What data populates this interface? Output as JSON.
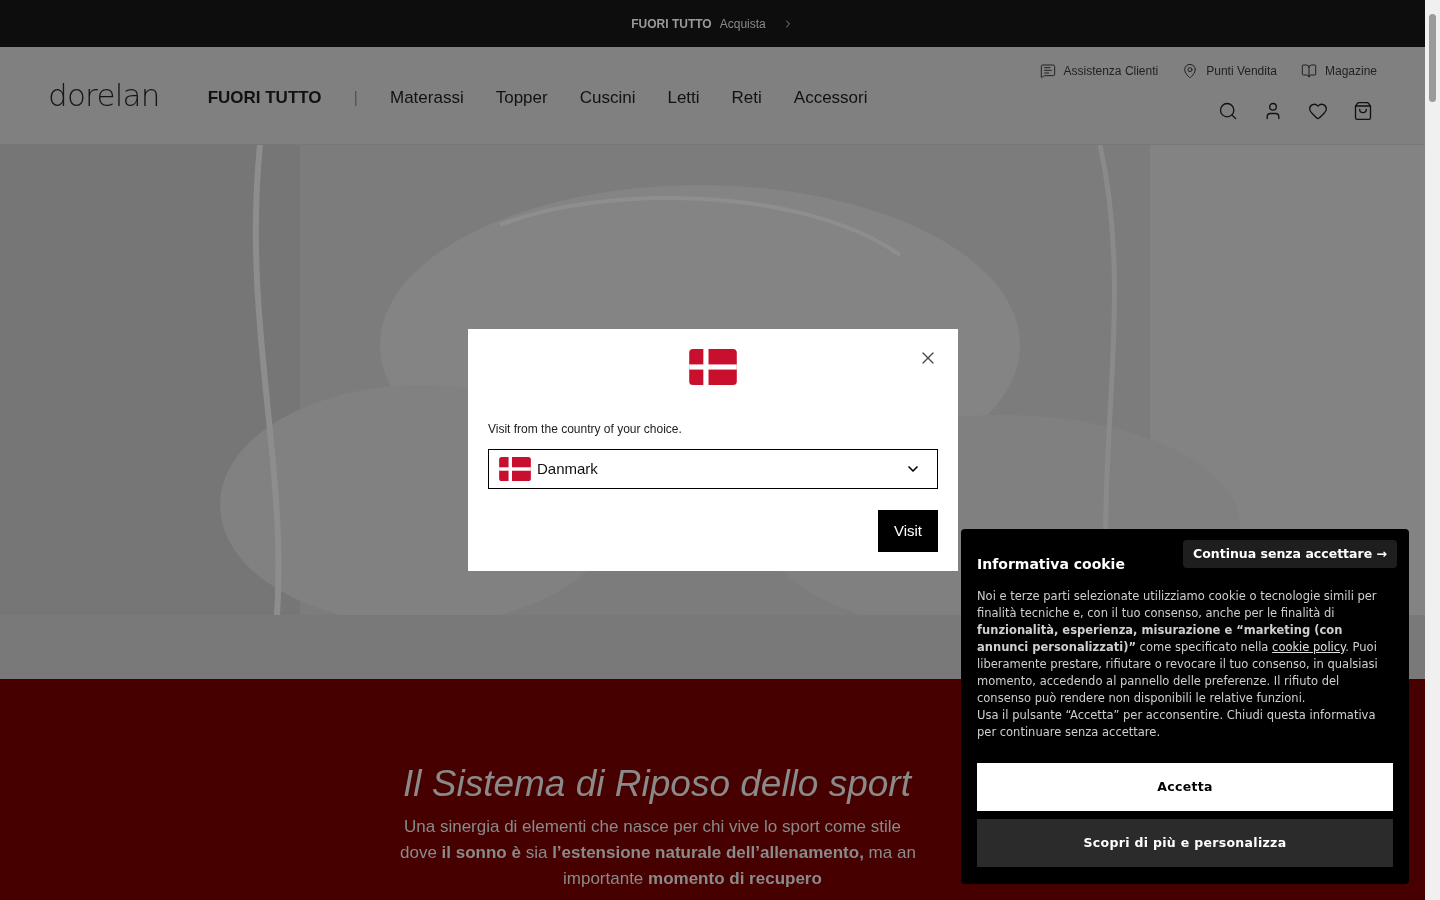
{
  "promo_bar": {
    "title": "FUORI TUTTO",
    "link": "Acquista"
  },
  "header": {
    "logo": "dorelan",
    "utility_links": [
      {
        "label": "Assistenza Clienti",
        "kind": "chat"
      },
      {
        "label": "Punti Vendita",
        "kind": "pin"
      },
      {
        "label": "Magazine",
        "kind": "book"
      }
    ],
    "nav": [
      {
        "label": "FUORI TUTTO",
        "kind": "highlight"
      },
      {
        "label": "|",
        "kind": "separator"
      },
      {
        "label": "Materassi",
        "kind": "link"
      },
      {
        "label": "Topper",
        "kind": "link"
      },
      {
        "label": "Cuscini",
        "kind": "link"
      },
      {
        "label": "Letti",
        "kind": "link"
      },
      {
        "label": "Reti",
        "kind": "link"
      },
      {
        "label": "Accessori",
        "kind": "link"
      }
    ],
    "actions": [
      {
        "kind": "search"
      },
      {
        "kind": "account"
      },
      {
        "kind": "wishlist"
      },
      {
        "kind": "cart"
      }
    ]
  },
  "intro_section": {
    "heading": "Il Sistema di Riposo dello sport",
    "lines": [
      "Una sinergia di elementi che nasce per chi vive lo sport come stile",
      "dove **il sonno è** sia **l’estensione naturale dell’allenamento,** ma an",
      "importante **momento di recupero**"
    ]
  },
  "country_modal": {
    "prompt": "Visit from the country of your choice.",
    "country": "Danmark",
    "button": "Visit"
  },
  "cookie_banner": {
    "title": "Informativa cookie",
    "skip_button": "Continua senza accettare →",
    "body_before_link": "Noi e terze parti selezionate utilizziamo cookie o tecnologie simili per finalità tecniche e, con il tuo consenso, anche per le finalità di **funzionalità, esperienza, misurazione e “marketing (con annunci personalizzati)”** come specificato nella ",
    "link": "cookie policy",
    "body_after_link": ". Puoi liberamente prestare, rifiutare o revocare il tuo consenso, in qualsiasi momento, accedendo al pannello delle preferenze. Il rifiuto del consenso può rendere non disponibili le relative funzioni.",
    "body_note": "Usa il pulsante “Accetta” per acconsentire. Chiudi questa informativa per continuare senza accettare.",
    "accept_button": "Accetta",
    "customize_button": "Scopri di più e personalizza"
  }
}
